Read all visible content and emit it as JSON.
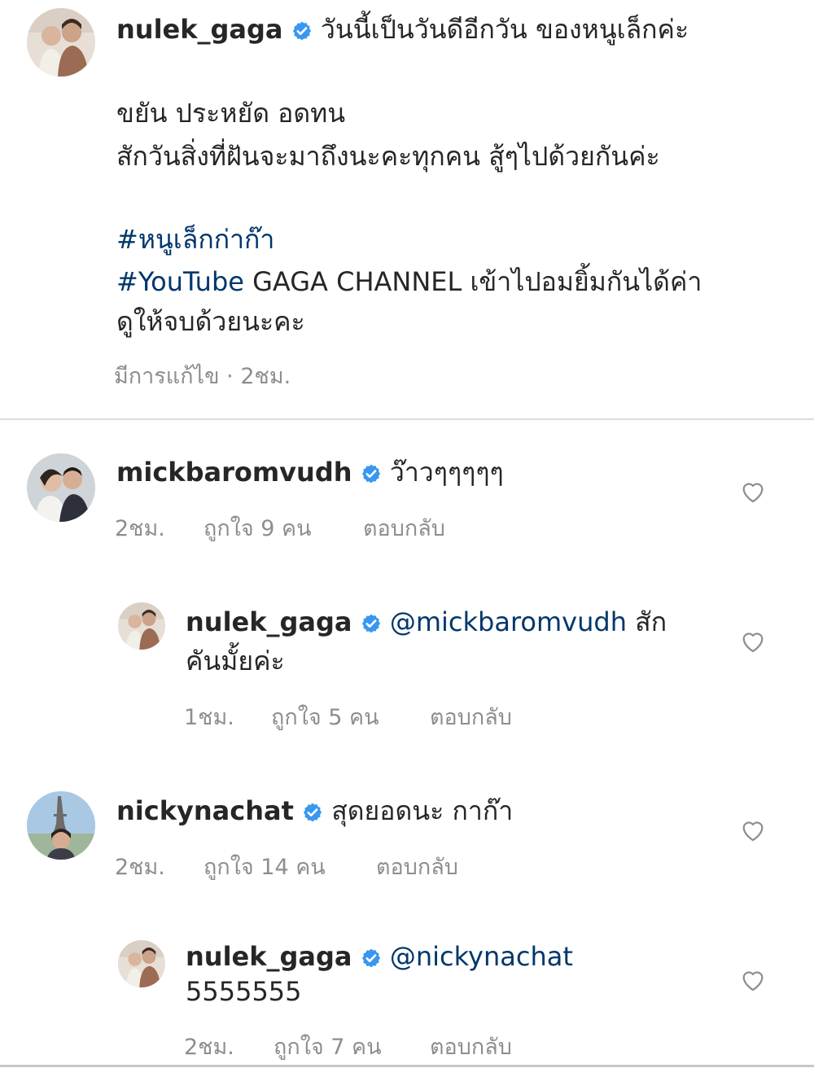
{
  "caption": {
    "username": "nulek_gaga",
    "first_line": "วันนี้เป็นวันดีอีกวัน ของหนูเล็กค่ะ",
    "lines": [
      "ขยัน ประหยัด อดทน",
      "สักวันสิ่งที่ฝันจะมาถึงนะคะทุกคน สู้ๆไปด้วยกันค่ะ"
    ],
    "hashtag_1": "#หนูเล็กก่าก๊า",
    "hashtag_2": "#YouTube",
    "hashtag_2_rest": " GAGA CHANNEL เข้าไปอมยิ้มกันได้ค่า",
    "last_line": "ดูให้จบด้วยนะคะ",
    "meta": "มีการแก้ไข · 2ชม."
  },
  "comments": [
    {
      "username": "mickbaromvudh",
      "text": "ว๊าวๆๆๆๆๆ",
      "time": "2ชม.",
      "likes": "ถูกใจ 9 คน",
      "reply": "ตอบกลับ"
    },
    {
      "username": "nulek_gaga",
      "mention": "@mickbaromvudh",
      "text_1": " สัก",
      "text_2": "คันมั้ยค่ะ",
      "time": "1ชม.",
      "likes": "ถูกใจ 5 คน",
      "reply": "ตอบกลับ"
    },
    {
      "username": "nickynachat",
      "text": "สุดยอดนะ กาก๊า",
      "time": "2ชม.",
      "likes": "ถูกใจ 14 คน",
      "reply": "ตอบกลับ"
    },
    {
      "username": "nulek_gaga",
      "mention": "@nickynachat",
      "text_2": "5555555",
      "time": "2ชม.",
      "likes": "ถูกใจ 7 คน",
      "reply": "ตอบกลับ"
    }
  ],
  "icons": {
    "verified": "verified-badge-icon",
    "like": "heart-outline-icon"
  },
  "colors": {
    "text": "#262626",
    "secondary": "#8e8e8e",
    "hashtag": "#00376b",
    "verified": "#3897f0",
    "divider": "#dbdbdb"
  }
}
